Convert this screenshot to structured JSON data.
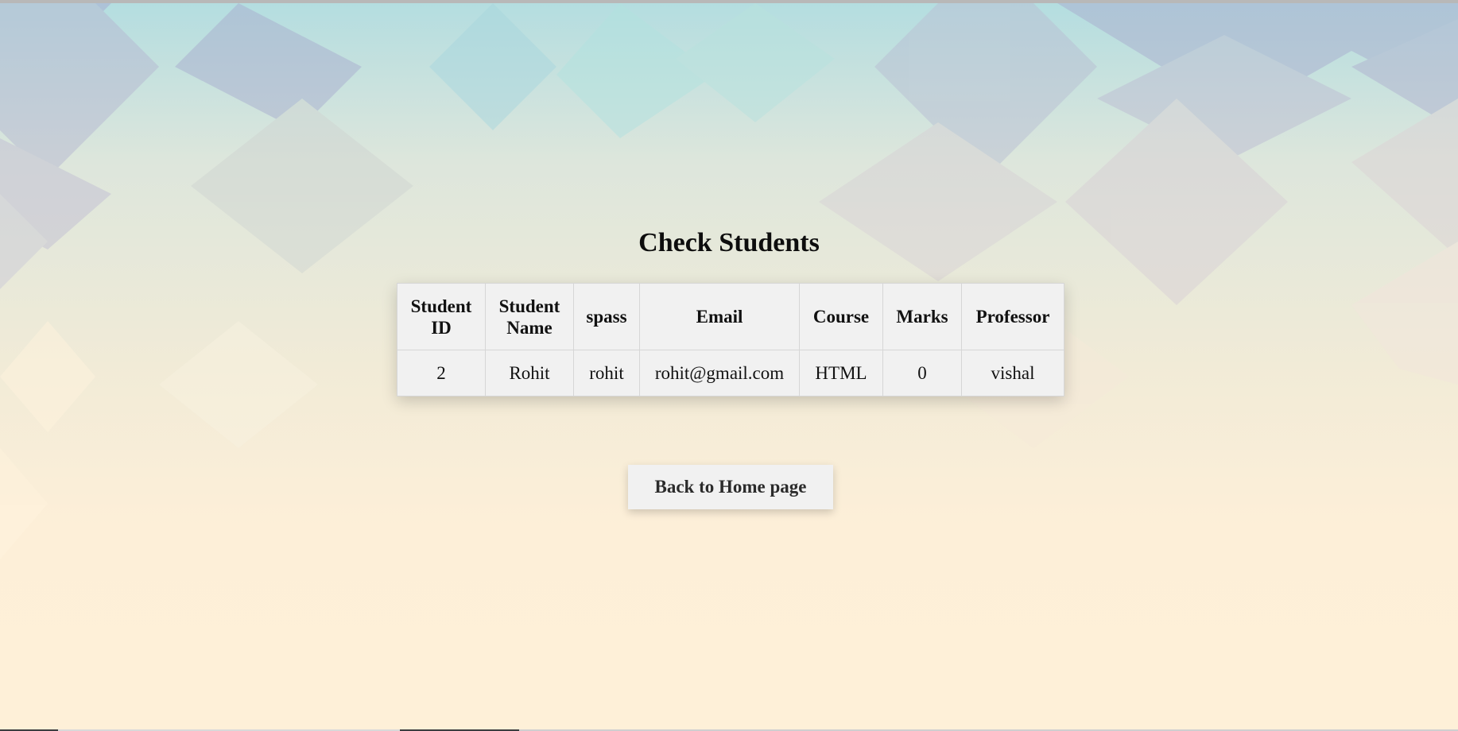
{
  "page": {
    "title": "Check Students"
  },
  "table": {
    "headers": [
      {
        "line1": "Student",
        "line2": "ID"
      },
      {
        "line1": "Student",
        "line2": "Name"
      },
      {
        "line1": "spass",
        "line2": ""
      },
      {
        "line1": "Email",
        "line2": ""
      },
      {
        "line1": "Course",
        "line2": ""
      },
      {
        "line1": "Marks",
        "line2": ""
      },
      {
        "line1": "Professor",
        "line2": ""
      }
    ],
    "rows": [
      [
        "2",
        "Rohit",
        "rohit",
        "rohit@gmail.com",
        "HTML",
        "0",
        "vishal"
      ]
    ]
  },
  "actions": {
    "back_label": "Back to Home page"
  },
  "colors": {
    "table_bg": "#f1f1f1",
    "button_bg": "#f1f1f1",
    "text": "#111111"
  }
}
